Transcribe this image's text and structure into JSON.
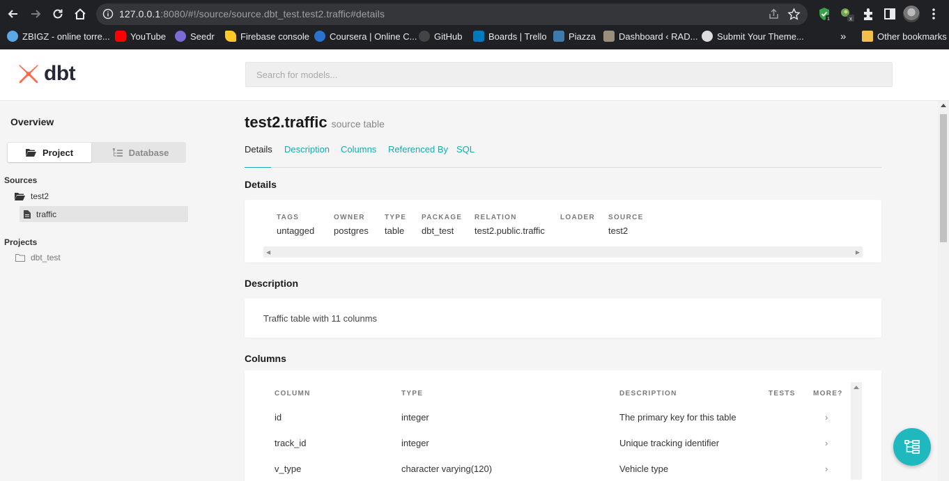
{
  "browser": {
    "url_host": "127.0.0.1",
    "url_rest": ":8080/#!/source/source.dbt_test.test2.traffic#details",
    "bookmarks": [
      {
        "label": "ZBIGZ - online torre...",
        "icon": "cloud-icon",
        "color": "#5aa9e6"
      },
      {
        "label": "YouTube",
        "icon": "youtube-icon",
        "color": "#ff0000"
      },
      {
        "label": "Seedr",
        "icon": "seedr-icon",
        "color": "#7a6cd6"
      },
      {
        "label": "Firebase console",
        "icon": "firebase-icon",
        "color": "#ffca28"
      },
      {
        "label": "Coursera | Online C...",
        "icon": "coursera-icon",
        "color": "#2a73cc"
      },
      {
        "label": "GitHub",
        "icon": "github-icon",
        "color": "#444444"
      },
      {
        "label": "Boards | Trello",
        "icon": "trello-icon",
        "color": "#0079bf"
      },
      {
        "label": "Piazza",
        "icon": "piazza-icon",
        "color": "#3e7aab"
      },
      {
        "label": "Dashboard ‹ RAD...",
        "icon": "dashboard-icon",
        "color": "#9a8f7a"
      },
      {
        "label": "Submit Your Theme...",
        "icon": "wordpress-icon",
        "color": "#dddddd"
      }
    ],
    "more_bookmarks": "»",
    "other_bookmarks": "Other bookmarks"
  },
  "app": {
    "logo_text": "dbt",
    "search_placeholder": "Search for models...",
    "brand_color": "#ff694b",
    "accent_color": "#1fb8bf"
  },
  "sidebar": {
    "overview": "Overview",
    "project_btn": "Project",
    "database_btn": "Database",
    "sources_title": "Sources",
    "source_group": "test2",
    "source_table": "traffic",
    "projects_title": "Projects",
    "project_name": "dbt_test"
  },
  "main": {
    "title": "test2.traffic",
    "subtitle": "source table",
    "tabs": [
      "Details",
      "Description",
      "Columns",
      "Referenced By",
      "SQL"
    ],
    "details_heading": "Details",
    "details": [
      {
        "label": "TAGS",
        "value": "untagged"
      },
      {
        "label": "OWNER",
        "value": "postgres"
      },
      {
        "label": "TYPE",
        "value": "table"
      },
      {
        "label": "PACKAGE",
        "value": "dbt_test"
      },
      {
        "label": "RELATION",
        "value": "test2.public.traffic"
      },
      {
        "label": "LOADER",
        "value": ""
      },
      {
        "label": "SOURCE",
        "value": "test2"
      }
    ],
    "description_heading": "Description",
    "description": "Traffic table with 11 colunms",
    "columns_heading": "Columns",
    "column_headers": [
      "COLUMN",
      "TYPE",
      "DESCRIPTION",
      "TESTS",
      "MORE?"
    ],
    "columns": [
      {
        "name": "id",
        "type": "integer",
        "description": "The primary key for this table",
        "more": "›"
      },
      {
        "name": "track_id",
        "type": "integer",
        "description": "Unique tracking identifier",
        "more": "›"
      },
      {
        "name": "v_type",
        "type": "character varying(120)",
        "description": "Vehicle type",
        "more": "›"
      }
    ]
  }
}
